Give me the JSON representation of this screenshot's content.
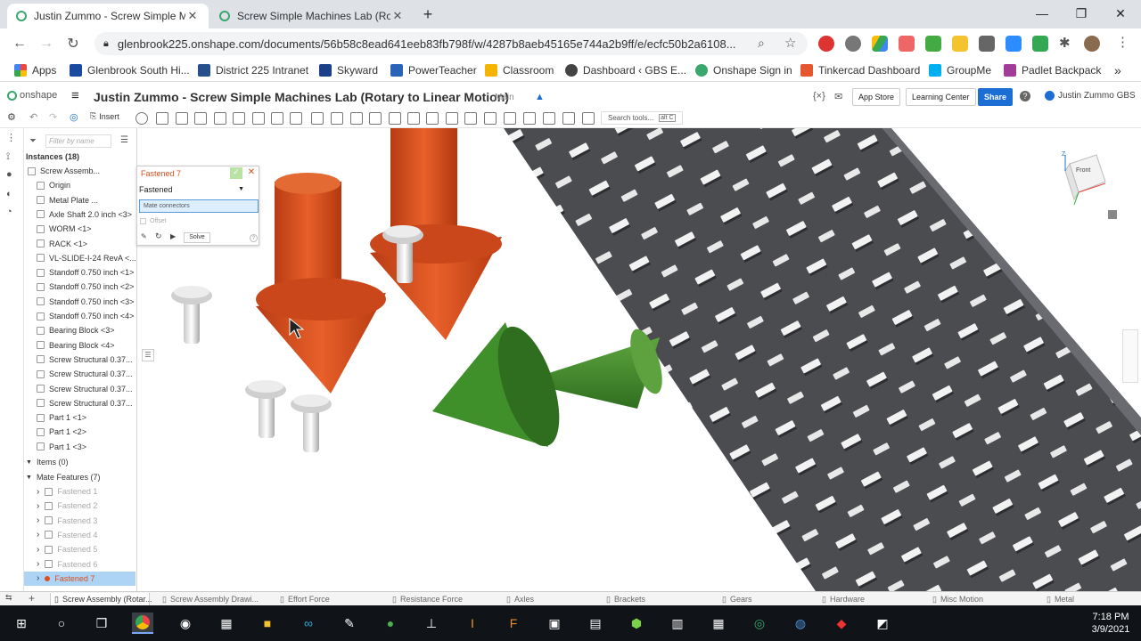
{
  "browser": {
    "tabs": [
      {
        "title": "Justin Zummo - Screw Simple Ma",
        "active": true
      },
      {
        "title": "Screw Simple Machines Lab (Rot",
        "active": false
      }
    ],
    "new_tab": "+",
    "window_controls": {
      "minimize": "—",
      "restore": "❐",
      "close": "✕"
    },
    "url": "glenbrook225.onshape.com/documents/56b58c8ead641eeb83fb798f/w/4287b8aeb45165e744a2b9ff/e/ecfc50b2a6108...",
    "bookmarks": [
      {
        "label": "Apps",
        "color": "#e44"
      },
      {
        "label": "Glenbrook South Hi...",
        "color": "#1a4aa0"
      },
      {
        "label": "District 225 Intranet",
        "color": "#25508c"
      },
      {
        "label": "Skyward",
        "color": "#1c3f8a"
      },
      {
        "label": "PowerTeacher",
        "color": "#2a62b8"
      },
      {
        "label": "Classroom",
        "color": "#f4b400"
      },
      {
        "label": "Dashboard ‹ GBS E...",
        "color": "#444"
      },
      {
        "label": "Onshape Sign in",
        "color": "#3aa76d"
      },
      {
        "label": "Tinkercad Dashboard",
        "color": "#e4572e"
      },
      {
        "label": "GroupMe",
        "color": "#00aff0"
      },
      {
        "label": "Padlet Backpack",
        "color": "#a33b99"
      }
    ],
    "bookmarks_more": "»"
  },
  "onshape": {
    "logo": "onshape",
    "document_title": "Justin Zummo - Screw Simple Machines Lab (Rotary to Linear Motion)",
    "workspace": "Main",
    "header_buttons": {
      "app_store": "App Store",
      "learning_center": "Learning Center",
      "share": "Share",
      "help": "?",
      "user": "Justin Zummo GBS"
    },
    "toolbar": {
      "insert": "Insert",
      "search_placeholder": "Search tools...",
      "search_shortcut": "alt C"
    },
    "filter_placeholder": "Filter by name",
    "instances_header": "Instances (18)",
    "instances": [
      {
        "label": "Screw Assemb...",
        "indent": 0
      },
      {
        "label": "Origin",
        "indent": 1
      },
      {
        "label": "Metal Plate ...",
        "indent": 1
      },
      {
        "label": "Axle Shaft 2.0 inch <3>",
        "indent": 1
      },
      {
        "label": "WORM <1>",
        "indent": 1
      },
      {
        "label": "RACK <1>",
        "indent": 1
      },
      {
        "label": "VL-SLIDE-I-24 RevA <...",
        "indent": 1
      },
      {
        "label": "Standoff 0.750 inch <1>",
        "indent": 1
      },
      {
        "label": "Standoff 0.750 inch <2>",
        "indent": 1
      },
      {
        "label": "Standoff 0.750 inch <3>",
        "indent": 1
      },
      {
        "label": "Standoff 0.750 inch <4>",
        "indent": 1
      },
      {
        "label": "Bearing Block <3>",
        "indent": 1
      },
      {
        "label": "Bearing Block <4>",
        "indent": 1
      },
      {
        "label": "Screw Structural 0.37...",
        "indent": 1
      },
      {
        "label": "Screw Structural 0.37...",
        "indent": 1
      },
      {
        "label": "Screw Structural 0.37...",
        "indent": 1
      },
      {
        "label": "Screw Structural 0.37...",
        "indent": 1
      },
      {
        "label": "Part 1 <1>",
        "indent": 1
      },
      {
        "label": "Part 1 <2>",
        "indent": 1
      },
      {
        "label": "Part 1 <3>",
        "indent": 1
      }
    ],
    "items_header": "Items (0)",
    "mate_features_header": "Mate Features (7)",
    "mate_features": [
      "Fastened 1",
      "Fastened 2",
      "Fastened 3",
      "Fastened 4",
      "Fastened 5",
      "Fastened 6",
      "Fastened 7"
    ],
    "dialog": {
      "title": "Fastened 7",
      "type": "Fastened",
      "connectors_field": "Mate connectors",
      "offset": "Offset",
      "solve": "Solve"
    },
    "view_cube": {
      "face": "Front",
      "top_axis": "Z"
    },
    "bottom_tabs": [
      "Screw Assembly (Rotar...",
      "Screw Assembly Drawi...",
      "Effort Force",
      "Resistance Force",
      "Axles",
      "Brackets",
      "Gears",
      "Hardware",
      "Misc Motion",
      "Metal"
    ]
  },
  "taskbar": {
    "time": "7:18 PM",
    "date": "3/9/2021"
  },
  "colors": {
    "orange_part": "#d9501f",
    "green_part": "#3f8f2a",
    "plate": "#4a4b4f",
    "onshape_blue": "#1c6ed4"
  }
}
